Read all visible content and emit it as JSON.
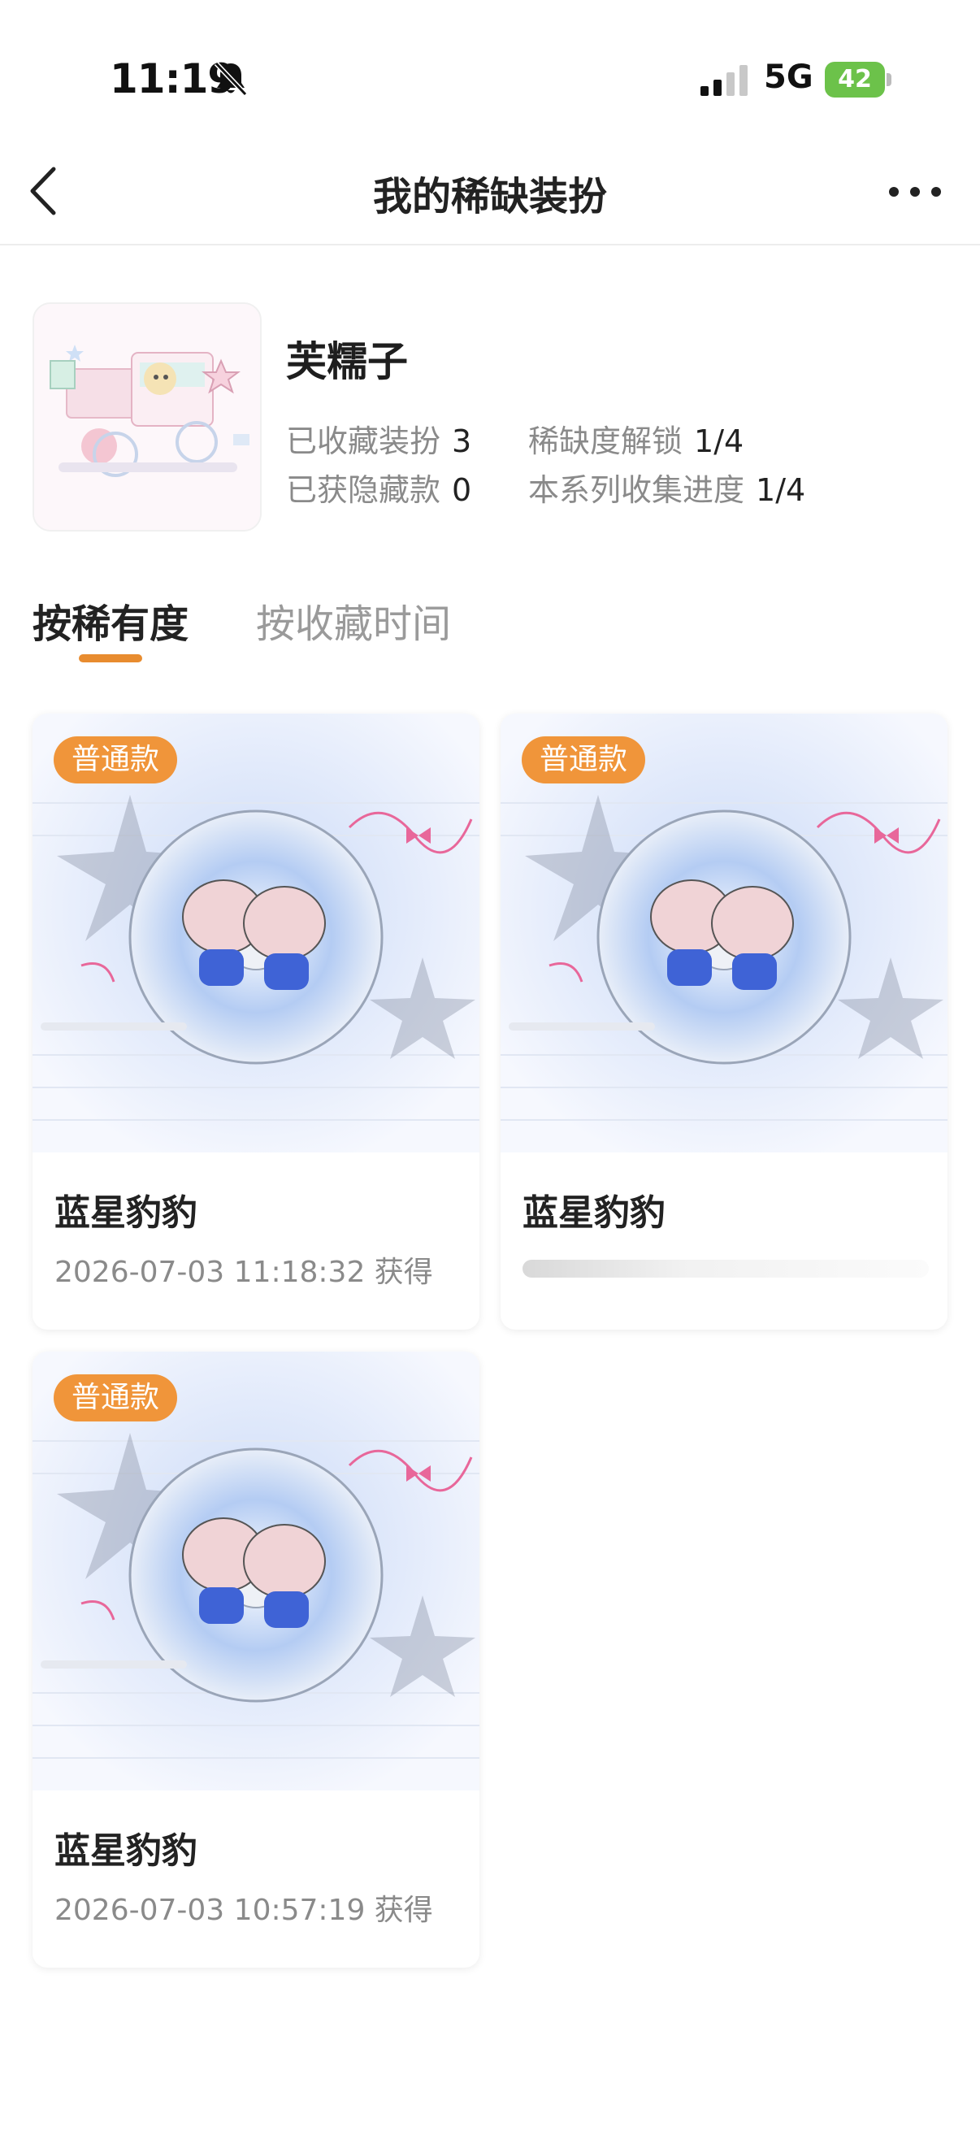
{
  "status_bar": {
    "time": "11:19",
    "network": "5G",
    "battery": "42"
  },
  "navbar": {
    "title": "我的稀缺装扮"
  },
  "profile": {
    "name": "芙糯子",
    "stats": [
      {
        "label": "已收藏装扮",
        "value": "3"
      },
      {
        "label": "稀缺度解锁",
        "value": "1/4"
      },
      {
        "label": "已获隐藏款",
        "value": "0"
      },
      {
        "label": "本系列收集进度",
        "value": "1/4"
      }
    ]
  },
  "tabs": {
    "active": "按稀有度",
    "inactive": "按收藏时间"
  },
  "cards": [
    {
      "badge": "普通款",
      "title": "蓝星豹豹",
      "date": "2026-07-03 11:18:32 获得"
    },
    {
      "badge": "普通款",
      "title": "蓝星豹豹",
      "date": ""
    },
    {
      "badge": "普通款",
      "title": "蓝星豹豹",
      "date": "2026-07-03 10:57:19 获得"
    }
  ],
  "colors": {
    "accent": "#e88c2f",
    "badge": "#f0953a",
    "battery": "#6cc24a"
  }
}
